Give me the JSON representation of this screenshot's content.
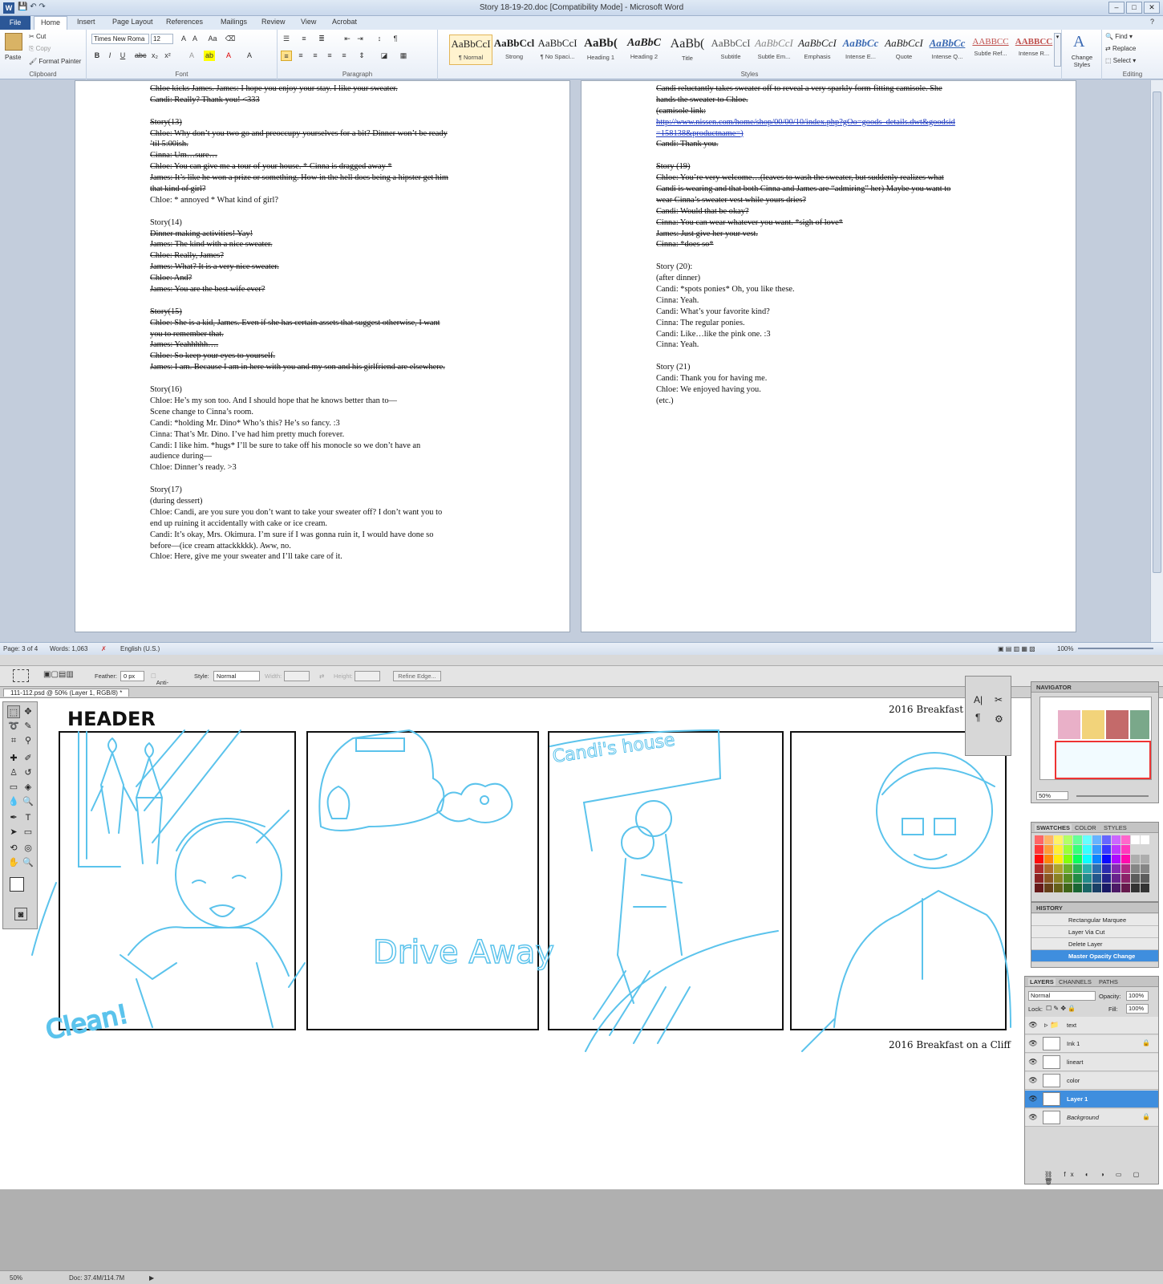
{
  "word": {
    "title": "Story 18-19-20.doc [Compatibility Mode] - Microsoft Word",
    "tabs": [
      "File",
      "Home",
      "Insert",
      "Page Layout",
      "References",
      "Mailings",
      "Review",
      "View",
      "Acrobat"
    ],
    "clipboard": {
      "paste": "Paste",
      "cut": "Cut",
      "copy": "Copy",
      "format_painter": "Format Painter",
      "label": "Clipboard"
    },
    "font": {
      "name": "Times New Roma",
      "size": "12",
      "label": "Font"
    },
    "paragraph_label": "Paragraph",
    "styles_label": "Styles",
    "styles": [
      {
        "preview": "AaBbCcI",
        "name": "¶ Normal"
      },
      {
        "preview": "AaBbCcl",
        "name": "Strong"
      },
      {
        "preview": "AaBbCcI",
        "name": "¶ No Spaci..."
      },
      {
        "preview": "AaBb(",
        "name": "Heading 1"
      },
      {
        "preview": "AaBbC",
        "name": "Heading 2"
      },
      {
        "preview": "AaBb(",
        "name": "Title"
      },
      {
        "preview": "AaBbCcI",
        "name": "Subtitle"
      },
      {
        "preview": "AaBbCcI",
        "name": "Subtle Em..."
      },
      {
        "preview": "AaBbCcI",
        "name": "Emphasis"
      },
      {
        "preview": "AaBbCc",
        "name": "Intense E..."
      },
      {
        "preview": "AaBbCcI",
        "name": "Quote"
      },
      {
        "preview": "AaBbCc",
        "name": "Intense Q..."
      },
      {
        "preview": "AABBCC",
        "name": "Subtle Ref..."
      },
      {
        "preview": "AABBCC",
        "name": "Intense R..."
      }
    ],
    "change_styles": "Change Styles",
    "editing": {
      "find": "Find",
      "replace": "Replace",
      "select": "Select",
      "label": "Editing"
    },
    "page_left": [
      {
        "t": "Chloe kicks James. James: I hope you enjoy your stay. I like your sweater.",
        "s": true
      },
      {
        "t": "Candi: Really? Thank you!  <333",
        "s": true
      },
      {
        "t": "",
        "s": false
      },
      {
        "t": "Story(13)",
        "s": true
      },
      {
        "t": "Chloe: Why don’t you two go and preoccupy yourselves  for a bit? Dinner won’t be ready",
        "s": true
      },
      {
        "t": "’til 5:00ish.",
        "s": true
      },
      {
        "t": "Cinna: Um…sure…",
        "s": true
      },
      {
        "t": "Chloe: You can give me a tour of your house.  * Cinna is dragged away *",
        "s": true
      },
      {
        "t": "James: It’s like he won a prize or something. How in the hell does being a hipster get him",
        "s": true
      },
      {
        "t": "that kind of girl?",
        "s": true
      },
      {
        "t": "Chloe: * annoyed * What kind of girl?",
        "s": false
      },
      {
        "t": "",
        "s": false
      },
      {
        "t": "Story(14)",
        "s": false
      },
      {
        "t": "Dinner making activities! Yay!",
        "s": true
      },
      {
        "t": "James:  The kind with a nice sweater.",
        "s": true
      },
      {
        "t": "Chloe: Really, James?",
        "s": true
      },
      {
        "t": "James: What? It is a very nice sweater.",
        "s": true
      },
      {
        "t": "Chloe: And?",
        "s": true
      },
      {
        "t": "James: You are the best wife ever?",
        "s": true
      },
      {
        "t": "",
        "s": false
      },
      {
        "t": "Story(15)",
        "s": true
      },
      {
        "t": "Chloe: She is a kid, James. Even if she has certain assets that suggest otherwise, I want",
        "s": true
      },
      {
        "t": "you to remember that.",
        "s": true
      },
      {
        "t": "James: Yeahhhhh….",
        "s": true
      },
      {
        "t": "Chloe: So keep your eyes to yourself.",
        "s": true
      },
      {
        "t": "James: I am. Because I am in here with you and my son and his girlfriend are elsewhere.",
        "s": true
      },
      {
        "t": "",
        "s": false
      },
      {
        "t": "Story(16)",
        "s": false
      },
      {
        "t": "Chloe: He’s my son too. And I should hope that he knows better than to—",
        "s": false
      },
      {
        "t": "Scene change to Cinna’s room.",
        "s": false
      },
      {
        "t": "Candi: *holding Mr. Dino* Who’s this? He’s so fancy. :3",
        "s": false
      },
      {
        "t": "Cinna: That’s Mr. Dino. I’ve had him pretty much forever.",
        "s": false
      },
      {
        "t": "Candi: I like him. *hugs* I’ll be sure to take off his monocle so we don’t have an",
        "s": false
      },
      {
        "t": "audience during—",
        "s": false
      },
      {
        "t": "Chloe: Dinner’s ready. >3",
        "s": false
      },
      {
        "t": "",
        "s": false
      },
      {
        "t": "Story(17)",
        "s": false
      },
      {
        "t": "(during dessert)",
        "s": false
      },
      {
        "t": "Chloe: Candi, are you sure you don’t want to take your sweater off? I don’t want you to",
        "s": false
      },
      {
        "t": "end up ruining it accidentally with cake or ice cream.",
        "s": false
      },
      {
        "t": "Candi: It’s okay, Mrs. Okimura. I’m sure if I was gonna ruin it, I would have done so",
        "s": false
      },
      {
        "t": "before—(ice cream attackkkkk). Aww, no.",
        "s": false
      },
      {
        "t": "Chloe: Here, give me your sweater and I’ll take care of it.",
        "s": false
      }
    ],
    "page_right": [
      {
        "t": "Candi reluctantly takes sweater off to reveal a very sparkly form-fitting camisole. She",
        "s": true
      },
      {
        "t": "hands the sweater to Chloe.",
        "s": true
      },
      {
        "t": "(camisole link:",
        "s": true
      },
      {
        "t": "http://www.nissen.com/home/shop/00/00/10/index.php?gOo=goods_details.dwt&goodsid",
        "s": true,
        "link": true
      },
      {
        "t": "=158138&productname=)",
        "s": true,
        "link": true
      },
      {
        "t": "Candi: Thank  you.",
        "s": true
      },
      {
        "t": "",
        "s": false
      },
      {
        "t": "Story (19)",
        "s": true
      },
      {
        "t": "Chloe: You’re very welcome…(leaves to wash the sweater, but suddenly realizes what",
        "s": true
      },
      {
        "t": "Candi is wearing and that both Cinna and James are “admiring” her) Maybe you want to",
        "s": true
      },
      {
        "t": "wear Cinna’s sweater vest while yours dries?",
        "s": true
      },
      {
        "t": "Candi: Would that be okay?",
        "s": true
      },
      {
        "t": "Cinna: You can wear whatever you want. *sigh of love*",
        "s": true
      },
      {
        "t": "James: Just give her your vest.",
        "s": true
      },
      {
        "t": "Cinna: *does so*",
        "s": true
      },
      {
        "t": "",
        "s": false
      },
      {
        "t": "Story (20):",
        "s": false
      },
      {
        "t": "(after dinner)",
        "s": false
      },
      {
        "t": "Candi: *spots ponies* Oh, you like these.",
        "s": false
      },
      {
        "t": "Cinna: Yeah.",
        "s": false
      },
      {
        "t": "Candi: What’s your favorite kind?",
        "s": false
      },
      {
        "t": "Cinna: The regular ponies.",
        "s": false
      },
      {
        "t": "Candi: Like…like the pink one. :3",
        "s": false
      },
      {
        "t": "Cinna: Yeah.",
        "s": false
      },
      {
        "t": "",
        "s": false
      },
      {
        "t": "Story (21)",
        "s": false
      },
      {
        "t": "Candi: Thank you for having me.",
        "s": false
      },
      {
        "t": "Chloe: We enjoyed having you.",
        "s": false
      },
      {
        "t": "(etc.)",
        "s": false
      }
    ],
    "status": {
      "page": "Page: 3 of 4",
      "words": "Words: 1,063",
      "language": "English (U.S.)",
      "zoom": "100%"
    }
  },
  "ps": {
    "options": {
      "feather_label": "Feather:",
      "feather_value": "0 px",
      "anti_alias": "Anti-alias",
      "style_label": "Style:",
      "style_value": "Normal",
      "width_label": "Width:",
      "height_label": "Height:",
      "refine": "Refine Edge..."
    },
    "doc_tab": "111-112.psd @ 50% (Layer 1, RGB/8) *",
    "canvas": {
      "header": "HEADER",
      "footer_top": "2016 Breakfast",
      "footer_bottom": "2016 Breakfast on a Cliff",
      "panel1_text": "Clean!",
      "panel2_text": "Drive Away",
      "panel3_text": "Candi's house"
    },
    "navigator": {
      "title": "NAVIGATOR",
      "zoom": "50%"
    },
    "swatches_tabs": [
      "SWATCHES",
      "COLOR",
      "STYLES"
    ],
    "history": {
      "title": "HISTORY",
      "items": [
        "Rectangular Marquee",
        "Layer Via Cut",
        "Delete Layer",
        "Master Opacity Change"
      ],
      "selected": 3
    },
    "layers": {
      "tabs": [
        "LAYERS",
        "CHANNELS",
        "PATHS"
      ],
      "blend": "Normal",
      "opacity_label": "Opacity:",
      "opacity": "100%",
      "lock_label": "Lock:",
      "fill_label": "Fill:",
      "fill": "100%",
      "items": [
        {
          "name": "text"
        },
        {
          "name": "Ink 1"
        },
        {
          "name": "lineart"
        },
        {
          "name": "color"
        },
        {
          "name": "Layer 1"
        },
        {
          "name": "Background"
        }
      ],
      "selected": 4
    },
    "status": {
      "zoom": "50%",
      "doc": "Doc: 37.4M/114.7M"
    }
  },
  "colors": {
    "sketch": "#5bc3ec",
    "selection": "#3f8ede",
    "word_blue": "#2b5797"
  }
}
